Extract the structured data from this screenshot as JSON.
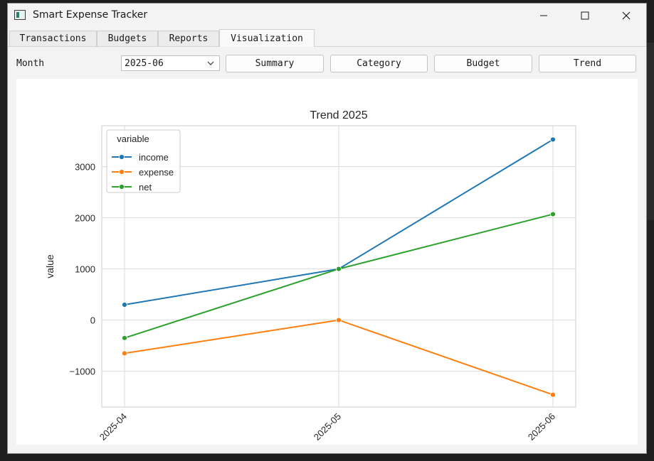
{
  "window": {
    "title": "Smart Expense Tracker",
    "controls": {
      "minimize": "minimize-icon",
      "maximize": "maximize-icon",
      "close": "close-icon"
    }
  },
  "tabs": [
    {
      "label": "Transactions",
      "active": false
    },
    {
      "label": "Budgets",
      "active": false
    },
    {
      "label": "Reports",
      "active": false
    },
    {
      "label": "Visualization",
      "active": true
    }
  ],
  "toolbar": {
    "month_label": "Month",
    "month_value": "2025-06",
    "buttons": {
      "summary": "Summary",
      "category": "Category",
      "budget": "Budget",
      "trend": "Trend"
    }
  },
  "colors": {
    "income": "#1f77b4",
    "expense": "#ff7f0e",
    "net": "#2ca02c"
  },
  "chart_data": {
    "type": "line",
    "title": "Trend 2025",
    "xlabel": "",
    "ylabel": "value",
    "categories": [
      "2025-04",
      "2025-05",
      "2025-06"
    ],
    "yticks": [
      -1000,
      0,
      1000,
      2000,
      3000
    ],
    "ytick_labels": [
      "−1000",
      "0",
      "1000",
      "2000",
      "3000"
    ],
    "ylim": [
      -1700,
      3800
    ],
    "grid": true,
    "legend": {
      "title": "variable",
      "placement": "top-left"
    },
    "series": [
      {
        "name": "income",
        "values": [
          300,
          1000,
          3530
        ]
      },
      {
        "name": "expense",
        "values": [
          -650,
          0,
          -1460
        ]
      },
      {
        "name": "net",
        "values": [
          -350,
          1000,
          2070
        ]
      }
    ]
  }
}
